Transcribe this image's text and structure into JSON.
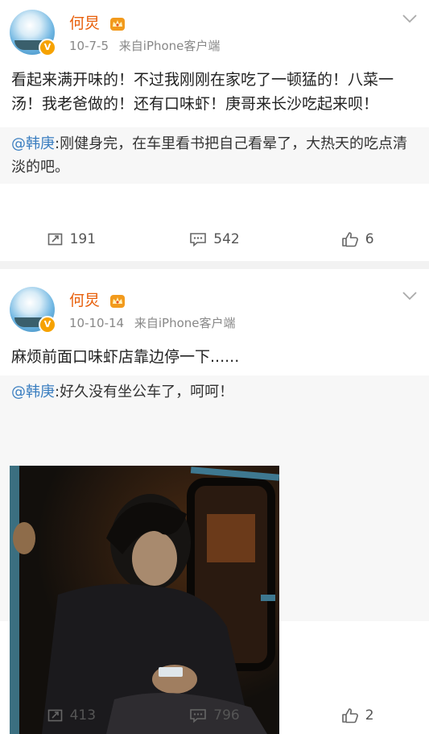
{
  "posts": [
    {
      "username": "何炅",
      "date": "10-7-5",
      "source": "来自iPhone客户端",
      "content": "看起来满开味的！不过我刚刚在家吃了一顿猛的！八菜一汤！我老爸做的！还有口味虾！庚哥来长沙吃起来呗！",
      "repost": {
        "mention": "@韩庚",
        "text": ":刚健身完，在车里看书把自己看晕了，大热天的吃点清淡的吧。"
      },
      "actions": {
        "reposts": "191",
        "comments": "542",
        "likes": "6"
      }
    },
    {
      "username": "何炅",
      "date": "10-10-14",
      "source": "来自iPhone客户端",
      "content": "麻烦前面口味虾店靠边停一下......",
      "repost": {
        "mention": "@韩庚",
        "text": ":好久没有坐公车了，呵呵！"
      },
      "actions": {
        "reposts": "413",
        "comments": "796",
        "likes": "2"
      }
    }
  ],
  "icons": {
    "repost": "repost-icon",
    "comment": "comment-icon",
    "like": "thumbs-up-icon",
    "more": "chevron-down-icon",
    "vip": "crown-icon",
    "verified": "verified-v-icon"
  },
  "colors": {
    "username": "#e8600c",
    "mention": "#3a7ec0",
    "meta": "#888888",
    "page_bg": "#f2f2f2",
    "repost_bg": "#f7f7f7"
  }
}
